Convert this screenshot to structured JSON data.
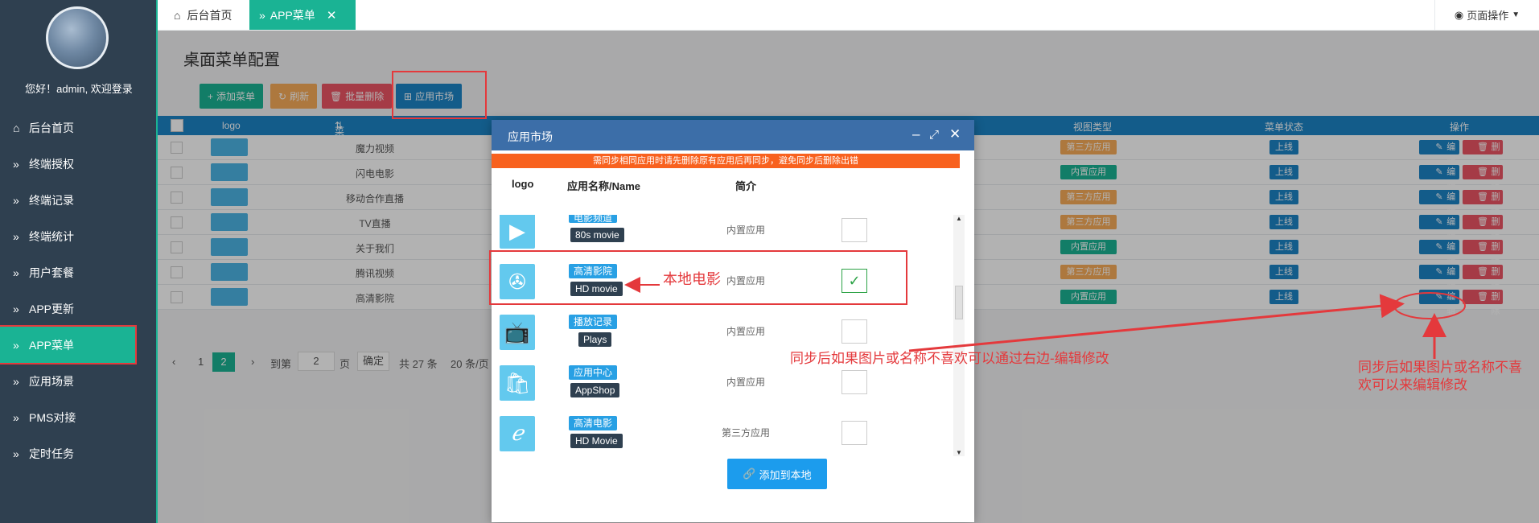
{
  "sidebar": {
    "welcome": "您好！admin, 欢迎登录",
    "items": [
      {
        "label": "后台首页",
        "icon": "home-icon"
      },
      {
        "label": "终端授权",
        "icon": "double-chevron-icon"
      },
      {
        "label": "终端记录",
        "icon": "double-chevron-icon"
      },
      {
        "label": "终端统计",
        "icon": "double-chevron-icon"
      },
      {
        "label": "用户套餐",
        "icon": "double-chevron-icon"
      },
      {
        "label": "APP更新",
        "icon": "double-chevron-icon"
      },
      {
        "label": "APP菜单",
        "icon": "double-chevron-icon"
      },
      {
        "label": "应用场景",
        "icon": "double-chevron-icon"
      },
      {
        "label": "PMS对接",
        "icon": "double-chevron-icon"
      },
      {
        "label": "定时任务",
        "icon": "double-chevron-icon"
      }
    ]
  },
  "tabs": {
    "home": "后台首页",
    "current": "APP菜单",
    "page_ops": "页面操作"
  },
  "content": {
    "title": "桌面菜单配置",
    "buttons": {
      "add": "添加菜单",
      "refresh": "刷新",
      "batch_delete": "批量删除",
      "market": "应用市场"
    },
    "columns": {
      "logo": "logo",
      "name": "菜单名称",
      "view_type": "视图类型",
      "status": "菜单状态",
      "action": "操作"
    },
    "rows": [
      {
        "name": "魔力视频",
        "type": "第三方应用",
        "status": "上线"
      },
      {
        "name": "闪电电影",
        "type": "内置应用",
        "status": "上线"
      },
      {
        "name": "移动合作直播",
        "type": "第三方应用",
        "status": "上线"
      },
      {
        "name": "TV直播",
        "type": "第三方应用",
        "status": "上线"
      },
      {
        "name": "关于我们",
        "type": "内置应用",
        "status": "上线"
      },
      {
        "name": "腾讯视频",
        "type": "第三方应用",
        "status": "上线"
      },
      {
        "name": "高清影院",
        "type": "内置应用",
        "status": "上线"
      }
    ],
    "edit_label": "编辑",
    "delete_label": "删除",
    "pager": {
      "page1": "1",
      "page2": "2",
      "goto": "到第",
      "input": "2",
      "unit": "页",
      "confirm": "确定",
      "total": "共 27 条",
      "per_page": "20 条/页"
    }
  },
  "modal": {
    "title": "应用市场",
    "warning": "需同步相同应用时请先删除原有应用后再同步，避免同步后删除出错",
    "columns": {
      "logo": "logo",
      "name": "应用名称/Name",
      "desc": "简介"
    },
    "apps": [
      {
        "cn": "电影频道",
        "en": "80s movie",
        "desc": "内置应用",
        "checked": false,
        "icon": "play-circle-icon"
      },
      {
        "cn": "高清影院",
        "en": "HD movie",
        "desc": "内置应用",
        "checked": true,
        "icon": "film-reel-icon"
      },
      {
        "cn": "播放记录",
        "en": "Plays",
        "desc": "内置应用",
        "checked": false,
        "icon": "tv-icon"
      },
      {
        "cn": "应用中心",
        "en": "AppShop",
        "desc": "内置应用",
        "checked": false,
        "icon": "shopping-bag-icon"
      },
      {
        "cn": "高清电影",
        "en": "HD Movie",
        "desc": "第三方应用",
        "checked": false,
        "icon": "letter-e-icon"
      }
    ],
    "add_button": "添加到本地",
    "check_mark": "✓"
  },
  "annotations": {
    "local_movie": "本地电影",
    "sync_note": "同步后如果图片或名称不喜欢可以通过右边-编辑修改",
    "sync_note_right_1": "同步后如果图片或名称不喜",
    "sync_note_right_2": "欢可以来编辑修改"
  },
  "colors": {
    "sidebar": "#2f4050",
    "accent": "#1ab394",
    "primary": "#1c84c6",
    "danger": "#ed5565",
    "warning": "#f8ac59",
    "annotation": "#e4393c"
  }
}
